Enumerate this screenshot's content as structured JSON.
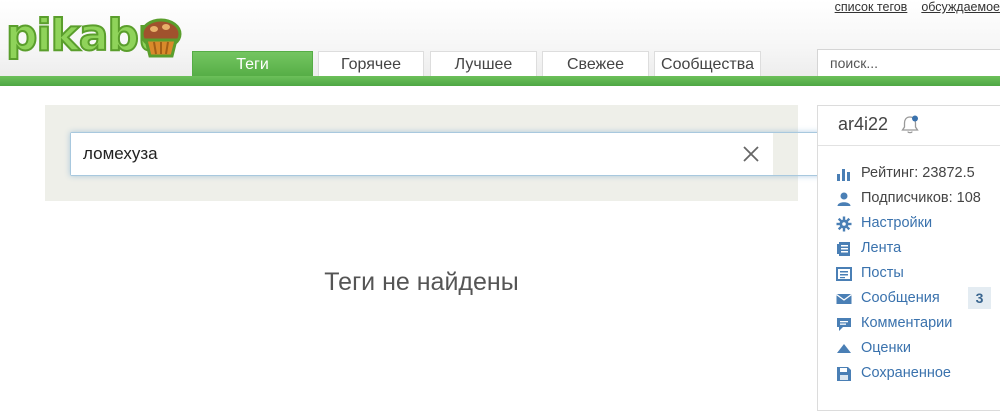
{
  "logo": {
    "text": "pikabu"
  },
  "top_links": [
    "список тегов",
    "обсуждаемое"
  ],
  "tabs": [
    {
      "label": "Теги",
      "active": true
    },
    {
      "label": "Горячее",
      "active": false
    },
    {
      "label": "Лучшее",
      "active": false
    },
    {
      "label": "Свежее",
      "active": false
    },
    {
      "label": "Сообщества",
      "active": false
    }
  ],
  "search": {
    "placeholder": "поиск..."
  },
  "tag_search": {
    "value": "ломехуза",
    "clear_icon": "close-icon"
  },
  "results": {
    "message": "Теги не найдены"
  },
  "sidebar": {
    "username": "ar4i22",
    "items": [
      {
        "label": "Рейтинг: 23872.5",
        "icon": "bar-chart-icon"
      },
      {
        "label": "Подписчиков: 108",
        "icon": "user-icon"
      },
      {
        "label": "Настройки",
        "icon": "gear-icon"
      },
      {
        "label": "Лента",
        "icon": "feed-icon"
      },
      {
        "label": "Посты",
        "icon": "posts-icon"
      },
      {
        "label": "Сообщения",
        "icon": "envelope-icon",
        "badge": "3"
      },
      {
        "label": "Комментарии",
        "icon": "comment-icon"
      },
      {
        "label": "Оценки",
        "icon": "triangle-up-icon"
      },
      {
        "label": "Сохраненное",
        "icon": "floppy-icon"
      }
    ]
  },
  "colors": {
    "brand_green": "#5cb85c",
    "link_blue": "#3a72ad",
    "icon_blue": "#4a7fb5",
    "panel_bg": "#eeefe9"
  }
}
